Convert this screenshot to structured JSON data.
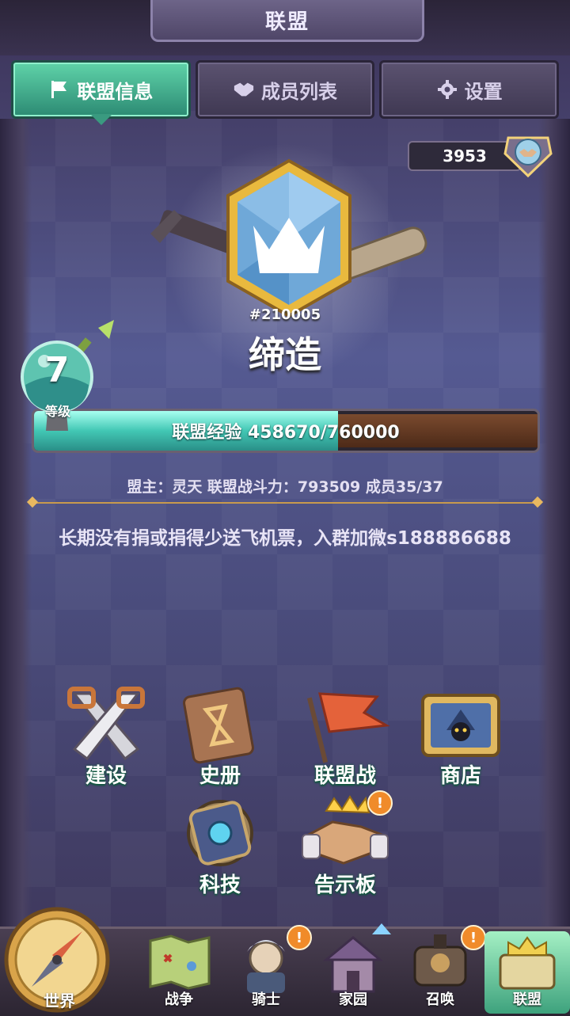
{
  "header": {
    "title": "联盟"
  },
  "tabs": [
    {
      "label": "联盟信息",
      "icon": "flag-icon",
      "active": true
    },
    {
      "label": "成员列表",
      "icon": "handshake-icon",
      "active": false
    },
    {
      "label": "设置",
      "icon": "gear-icon",
      "active": false
    }
  ],
  "score": {
    "value": "3953",
    "icon": "handshake-emblem-icon"
  },
  "alliance": {
    "id": "#210005",
    "name": "缔造",
    "level": "7",
    "level_label": "等级",
    "xp_text": "联盟经验 458670/760000",
    "xp_current": 458670,
    "xp_max": 760000,
    "stats": "盟主：灵天  联盟战斗力：793509 成员35/37",
    "notice": "长期没有捐或捐得少送飞机票，入群加微s188886688"
  },
  "features": [
    {
      "label": "建设",
      "icon": "saws-icon",
      "badge": false
    },
    {
      "label": "史册",
      "icon": "book-icon",
      "badge": false
    },
    {
      "label": "联盟战",
      "icon": "battle-flag-icon",
      "badge": false
    },
    {
      "label": "商店",
      "icon": "shop-icon",
      "badge": false
    },
    {
      "label": "科技",
      "icon": "tech-gear-icon",
      "badge": false
    },
    {
      "label": "告示板",
      "icon": "notice-board-icon",
      "badge": true,
      "badge_text": "!"
    }
  ],
  "nav": [
    {
      "label": "世界",
      "icon": "compass-icon"
    },
    {
      "label": "战争",
      "icon": "map-icon"
    },
    {
      "label": "骑士",
      "icon": "knight-icon",
      "badge_text": "!"
    },
    {
      "label": "家园",
      "icon": "house-icon"
    },
    {
      "label": "召唤",
      "icon": "train-icon",
      "badge_text": "!"
    },
    {
      "label": "联盟",
      "icon": "alliance-icon",
      "active": true
    }
  ],
  "colors": {
    "accent": "#42c7b4",
    "badge": "#f08b2a",
    "divider": "#c89a4d"
  }
}
